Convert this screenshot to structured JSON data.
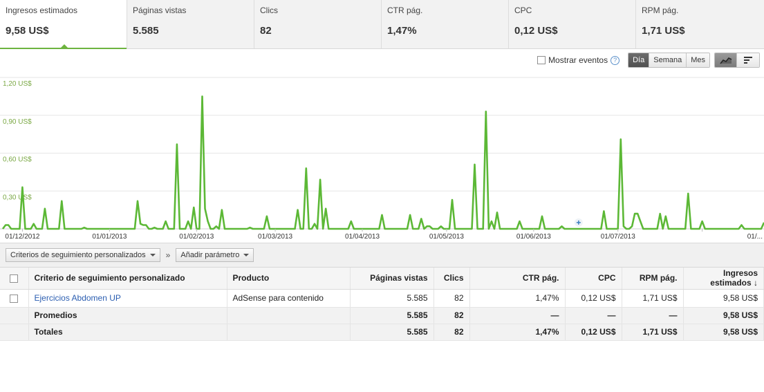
{
  "scorecards": [
    {
      "label": "Ingresos estimados",
      "value": "9,58 US$"
    },
    {
      "label": "Páginas vistas",
      "value": "5.585"
    },
    {
      "label": "Clics",
      "value": "82"
    },
    {
      "label": "CTR pág.",
      "value": "1,47%"
    },
    {
      "label": "CPC",
      "value": "0,12 US$"
    },
    {
      "label": "RPM pág.",
      "value": "1,71 US$"
    }
  ],
  "controls": {
    "show_events": "Mostrar eventos",
    "help": "?",
    "day": "Día",
    "week": "Semana",
    "month": "Mes"
  },
  "colors": {
    "accent": "#6db33f",
    "line": "#5cb836",
    "axis_text": "#7aa844"
  },
  "chart_data": {
    "type": "line",
    "y_ticks": [
      "1,20 US$",
      "0,90 US$",
      "0,60 US$",
      "0,30 US$"
    ],
    "y_tick_values": [
      1.2,
      0.9,
      0.6,
      0.3
    ],
    "ylim": [
      0,
      1.2
    ],
    "x_tick_labels": [
      "01/12/2012",
      "01/01/2013",
      "01/02/2013",
      "01/03/2013",
      "01/04/2013",
      "01/05/2013",
      "01/06/2013",
      "01/07/2013",
      "01/..."
    ],
    "x_tick_days": [
      7,
      38,
      69,
      97,
      128,
      158,
      189,
      219,
      249
    ],
    "series": [
      {
        "values": [
          0,
          0.03,
          0.03,
          0,
          0,
          0,
          0,
          0.33,
          0,
          0,
          0,
          0.04,
          0,
          0,
          0,
          0.16,
          0,
          0,
          0,
          0,
          0,
          0.22,
          0,
          0,
          0,
          0,
          0,
          0,
          0,
          0.01,
          0,
          0,
          0,
          0,
          0,
          0,
          0,
          0,
          0,
          0,
          0,
          0,
          0,
          0,
          0,
          0,
          0,
          0,
          0.22,
          0.04,
          0.03,
          0.03,
          0,
          0,
          0.01,
          0,
          0,
          0,
          0.06,
          0,
          0,
          0,
          0.67,
          0,
          0,
          0,
          0.06,
          0,
          0.17,
          0,
          0,
          1.05,
          0.16,
          0.06,
          0,
          0,
          0.02,
          0,
          0.15,
          0,
          0,
          0,
          0,
          0,
          0,
          0,
          0,
          0,
          0.01,
          0,
          0,
          0,
          0,
          0,
          0.1,
          0,
          0,
          0,
          0,
          0,
          0,
          0,
          0,
          0,
          0,
          0.15,
          0,
          0,
          0.48,
          0,
          0,
          0.04,
          0,
          0.39,
          0,
          0.16,
          0,
          0,
          0,
          0,
          0,
          0,
          0,
          0,
          0.06,
          0,
          0,
          0,
          0,
          0,
          0,
          0,
          0,
          0,
          0,
          0.11,
          0,
          0,
          0,
          0,
          0,
          0,
          0,
          0,
          0,
          0.11,
          0,
          0,
          0,
          0.08,
          0,
          0.02,
          0.02,
          0,
          0,
          0,
          0.02,
          0,
          0,
          0,
          0.23,
          0,
          0,
          0,
          0,
          0,
          0,
          0,
          0.51,
          0,
          0,
          0,
          0.93,
          0,
          0.06,
          0,
          0.13,
          0,
          0,
          0,
          0,
          0,
          0,
          0,
          0.06,
          0,
          0,
          0,
          0,
          0,
          0,
          0,
          0.1,
          0,
          0,
          0,
          0,
          0,
          0,
          0.02,
          0,
          0,
          0,
          0,
          0,
          0,
          0,
          0,
          0,
          0,
          0,
          0,
          0,
          0,
          0.14,
          0,
          0,
          0,
          0,
          0,
          0.71,
          0.02,
          0,
          0,
          0.02,
          0.12,
          0.12,
          0.06,
          0,
          0,
          0,
          0,
          0,
          0,
          0.12,
          0,
          0.1,
          0,
          0,
          0,
          0,
          0,
          0,
          0,
          0.28,
          0,
          0,
          0,
          0,
          0.06,
          0,
          0,
          0,
          0,
          0,
          0,
          0,
          0,
          0,
          0,
          0,
          0,
          0,
          0.03,
          0,
          0,
          0,
          0,
          0,
          0,
          0,
          0.05
        ]
      }
    ]
  },
  "dimension_bar": {
    "dimension": "Criterios de seguimiento personalizados",
    "separator": "»",
    "add_param": "Añadir parámetro"
  },
  "table": {
    "headers": {
      "channel": "Criterio de seguimiento personalizado",
      "product": "Producto",
      "pageviews": "Páginas vistas",
      "clicks": "Clics",
      "ctr": "CTR pág.",
      "cpc": "CPC",
      "rpm": "RPM pág.",
      "earnings": "Ingresos estimados ↓"
    },
    "rows": [
      {
        "channel": "Ejercicios Abdomen UP",
        "product": "AdSense para contenido",
        "pageviews": "5.585",
        "clicks": "82",
        "ctr": "1,47%",
        "cpc": "0,12 US$",
        "rpm": "1,71 US$",
        "earnings": "9,58 US$"
      }
    ],
    "averages": {
      "label": "Promedios",
      "pageviews": "5.585",
      "clicks": "82",
      "ctr": "—",
      "cpc": "—",
      "rpm": "—",
      "earnings": "9,58 US$"
    },
    "totals": {
      "label": "Totales",
      "pageviews": "5.585",
      "clicks": "82",
      "ctr": "1,47%",
      "cpc": "0,12 US$",
      "rpm": "1,71 US$",
      "earnings": "9,58 US$"
    }
  }
}
